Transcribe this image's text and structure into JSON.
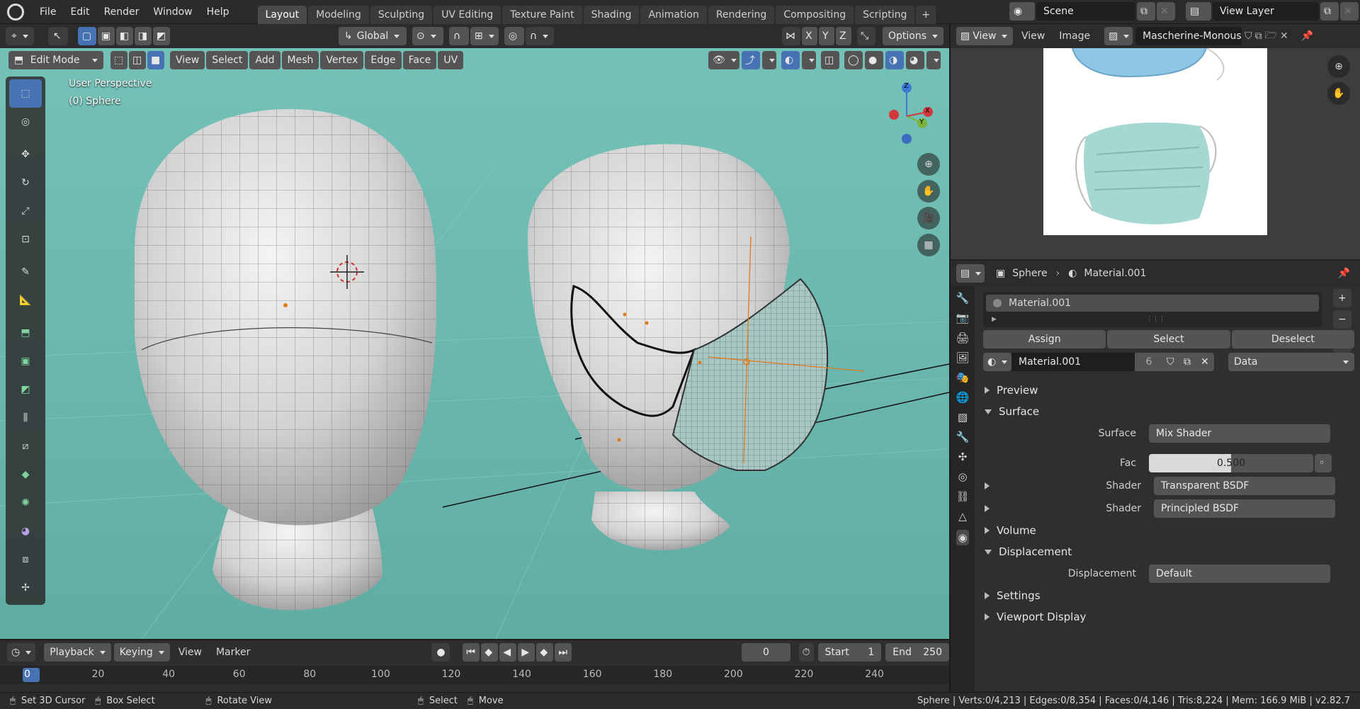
{
  "menu": {
    "file": "File",
    "edit": "Edit",
    "render": "Render",
    "window": "Window",
    "help": "Help"
  },
  "workspaces": [
    "Layout",
    "Modeling",
    "Sculpting",
    "UV Editing",
    "Texture Paint",
    "Shading",
    "Animation",
    "Rendering",
    "Compositing",
    "Scripting"
  ],
  "scene": {
    "name": "Scene",
    "view_layer": "View Layer"
  },
  "viewport": {
    "transform_orientation": "Global",
    "axes": [
      "X",
      "Y",
      "Z"
    ],
    "options": "Options",
    "mode": "Edit Mode",
    "menus": [
      "View",
      "Select",
      "Add",
      "Mesh",
      "Vertex",
      "Edge",
      "Face",
      "UV"
    ],
    "perspective": "User Perspective",
    "object_label": "(0) Sphere",
    "gizmo": {
      "z": "Z",
      "y": "Y",
      "x": "X"
    }
  },
  "image_editor": {
    "view": "View",
    "view_menu": "View",
    "image_menu": "Image",
    "image_name": "Mascherine-Monous.."
  },
  "properties": {
    "breadcrumb": {
      "object": "Sphere",
      "material": "Material.001"
    },
    "slot": "Material.001",
    "assign": "Assign",
    "select": "Select",
    "deselect": "Deselect",
    "material_name": "Material.001",
    "users": "6",
    "link": "Data",
    "panels": {
      "preview": "Preview",
      "surface": "Surface",
      "volume": "Volume",
      "displacement": "Displacement",
      "settings": "Settings",
      "viewport_display": "Viewport Display"
    },
    "surface_label": "Surface",
    "surface_value": "Mix Shader",
    "fac_label": "Fac",
    "fac_value": "0.500",
    "fac_fraction": 0.5,
    "shader1_label": "Shader",
    "shader1_value": "Transparent BSDF",
    "shader2_label": "Shader",
    "shader2_value": "Principled BSDF",
    "disp_label": "Displacement",
    "disp_value": "Default"
  },
  "timeline": {
    "playback": "Playback",
    "keying": "Keying",
    "view": "View",
    "marker": "Marker",
    "current_frame": "0",
    "start_label": "Start",
    "start": "1",
    "end_label": "End",
    "end": "250",
    "ruler": [
      "0",
      "20",
      "40",
      "60",
      "80",
      "100",
      "120",
      "140",
      "160",
      "180",
      "200",
      "220",
      "240"
    ]
  },
  "status": {
    "set_cursor": "Set 3D Cursor",
    "box_select": "Box Select",
    "rotate_view": "Rotate View",
    "select": "Select",
    "move": "Move",
    "stats": "Sphere | Verts:0/4,213 | Edges:0/8,354 | Faces:0/4,146 | Tris:8,224 | Mem: 166.9 MiB | v2.82.7"
  },
  "colors": {
    "accent": "#4772b3",
    "viewport_bg": "#6cbab0",
    "orange": "#e07b1a"
  }
}
